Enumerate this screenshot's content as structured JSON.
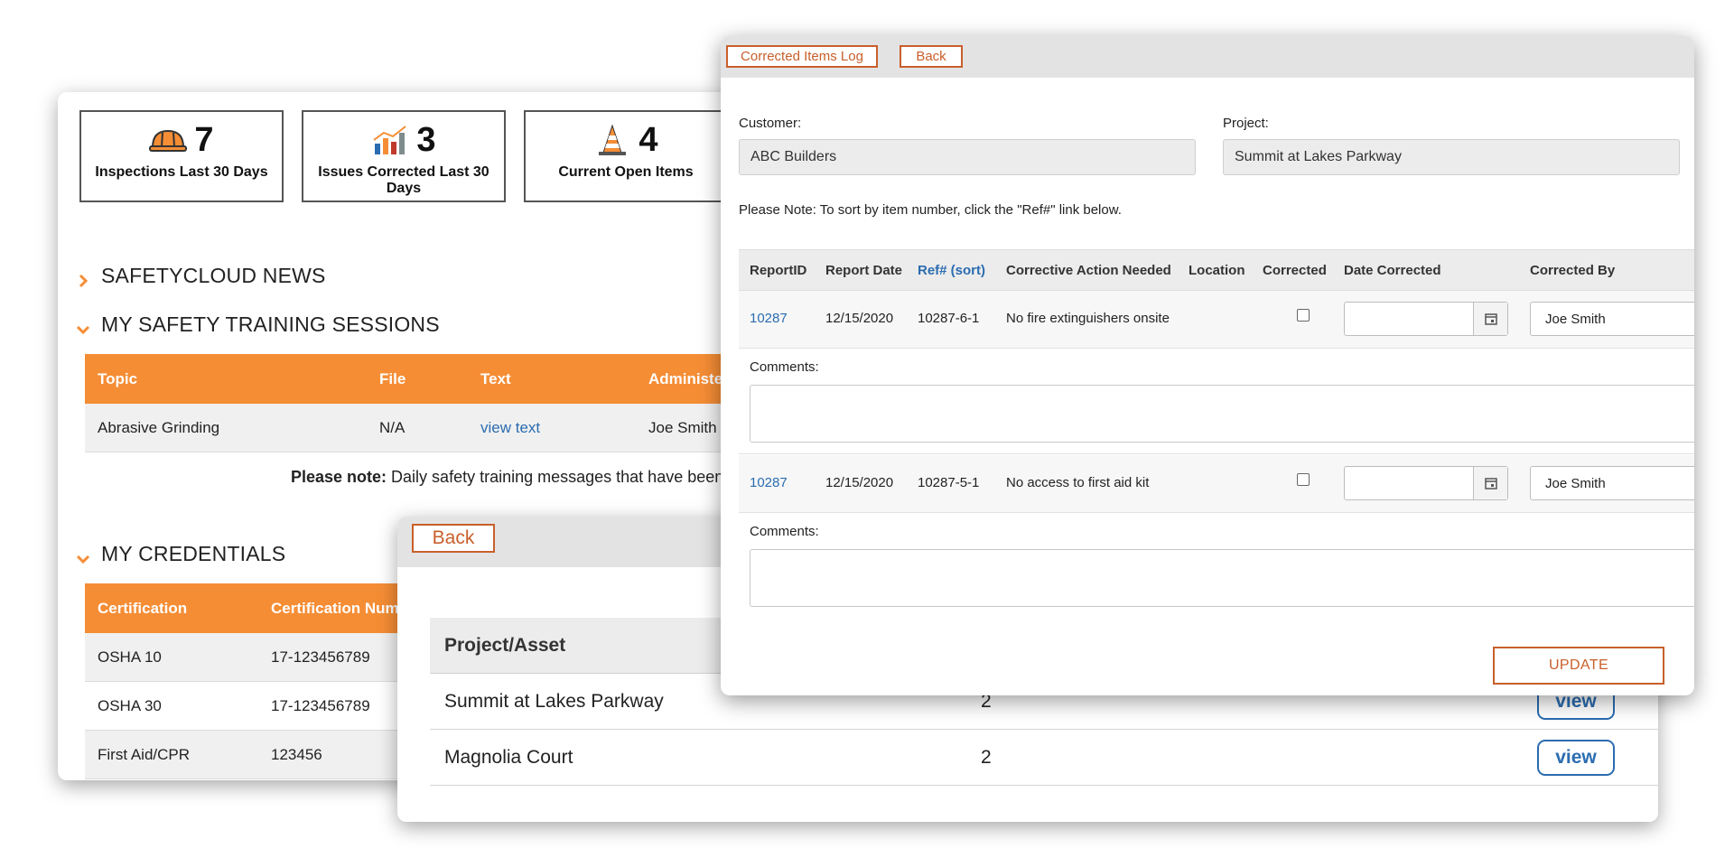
{
  "dashboard": {
    "stats": [
      {
        "count": "7",
        "label": "Inspections Last 30 Days",
        "icon": "hardhat-icon"
      },
      {
        "count": "3",
        "label": "Issues Corrected Last 30 Days",
        "icon": "bar-chart-icon"
      },
      {
        "count": "4",
        "label": "Current Open Items",
        "icon": "traffic-cone-icon"
      }
    ],
    "sections": {
      "news": "SAFETYCLOUD NEWS",
      "training": "MY SAFETY TRAINING SESSIONS",
      "credentials": "MY CREDENTIALS"
    },
    "training_table": {
      "headers": [
        "Topic",
        "File",
        "Text",
        "Administe"
      ],
      "rows": [
        {
          "topic": "Abrasive Grinding",
          "file": "N/A",
          "text": "view text",
          "admin": "Joe Smith"
        }
      ]
    },
    "note_bold": "Please note:",
    "note_text": " Daily safety training messages that have been sig",
    "credentials_table": {
      "headers": [
        "Certification",
        "Certification Num"
      ],
      "rows": [
        {
          "cert": "OSHA 10",
          "num": "17-123456789"
        },
        {
          "cert": "OSHA 30",
          "num": "17-123456789"
        },
        {
          "cert": "First Aid/CPR",
          "num": "123456"
        }
      ]
    }
  },
  "project_list": {
    "back_label": "Back",
    "headers": [
      "Project/Asset"
    ],
    "rows": [
      {
        "name": "Summit at Lakes Parkway",
        "count": "2",
        "action": "view"
      },
      {
        "name": "Magnolia Court",
        "count": "2",
        "action": "view"
      }
    ]
  },
  "corrected_items": {
    "log_label": "Corrected Items Log",
    "back_label": "Back",
    "customer_label": "Customer:",
    "customer_value": "ABC Builders",
    "project_label": "Project:",
    "project_value": "Summit at Lakes Parkway",
    "note": "Please Note: To sort by item number, click the \"Ref#\" link below.",
    "headers": [
      "ReportID",
      "Report Date",
      "Ref# (sort)",
      "Corrective Action Needed",
      "Location",
      "Corrected",
      "Date Corrected",
      "Corrected By"
    ],
    "comments_label": "Comments:",
    "items": [
      {
        "report_id": "10287",
        "report_date": "12/15/2020",
        "ref": "10287-6-1",
        "action": "No fire extinguishers onsite",
        "location": "",
        "corrected": false,
        "date_corrected": "",
        "corrected_by": "Joe Smith"
      },
      {
        "report_id": "10287",
        "report_date": "12/15/2020",
        "ref": "10287-5-1",
        "action": "No access to first aid kit",
        "location": "",
        "corrected": false,
        "date_corrected": "",
        "corrected_by": "Joe Smith"
      }
    ],
    "update_label": "UPDATE"
  },
  "colors": {
    "orange": "#f58d35",
    "orange_border": "#c85f2b",
    "link_blue": "#2b6cb0"
  }
}
